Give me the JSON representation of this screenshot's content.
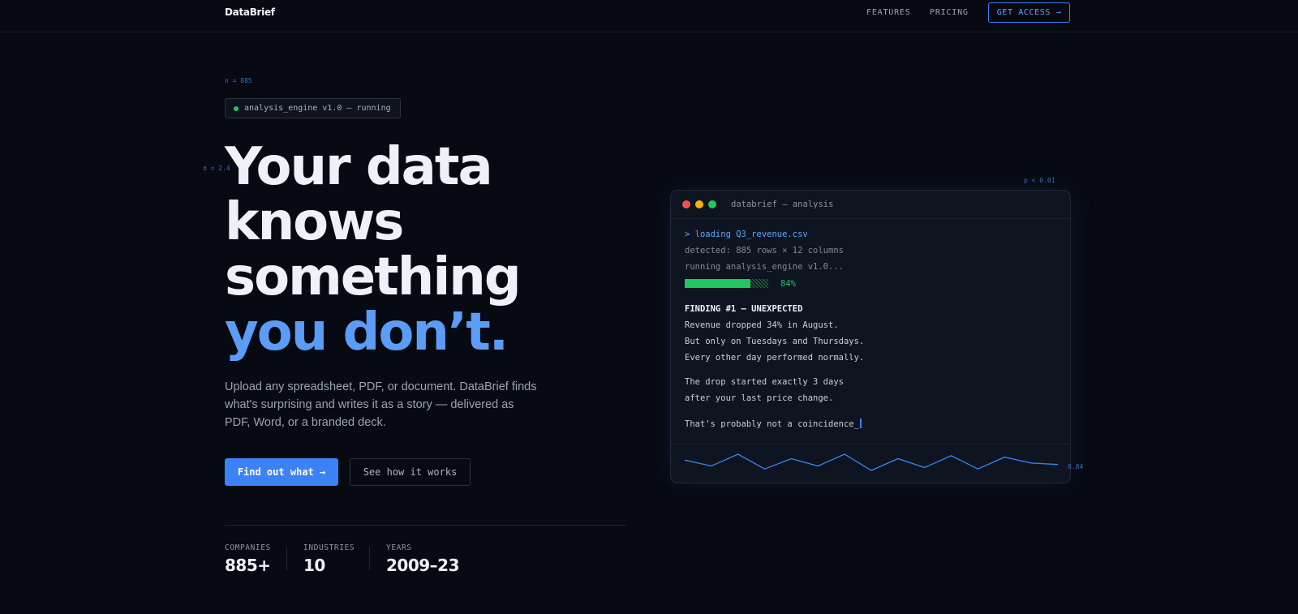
{
  "nav": {
    "logo": "DataBrief",
    "links": [
      "FEATURES",
      "PRICING"
    ],
    "cta": "GET ACCESS →"
  },
  "annotations": {
    "n": "n = 885",
    "sigma": "σ = 2.4",
    "p": "p < 0.01",
    "r": "0.84"
  },
  "status": {
    "text": "analysis_engine v1.0 — running",
    "color": "#22c55e"
  },
  "hero": {
    "line1": "Your data",
    "line2": "knows",
    "line3": "something",
    "accent": "you don’t.",
    "subtext": "Upload any spreadsheet, PDF, or document. DataBrief finds what's surprising and writes it as a story — delivered as PDF, Word, or a branded deck.",
    "primary_button": "Find out what →",
    "secondary_button": "See how it works"
  },
  "stats": [
    {
      "label": "COMPANIES",
      "value": "885+"
    },
    {
      "label": "INDUSTRIES",
      "value": "10"
    },
    {
      "label": "YEARS",
      "value": "2009–23"
    }
  ],
  "terminal": {
    "title": "databrief — analysis",
    "cmd": "> loading Q3_revenue.csv",
    "detected": "detected: 885 rows × 12 columns",
    "running": "running analysis_engine v1.0...",
    "progress_value": 0.84,
    "progress_label": "84%",
    "finding_title": "FINDING #1 — UNEXPECTED",
    "finding_lines": [
      "Revenue dropped 34% in August.",
      "But only on Tuesdays and Thursdays.",
      "Every other day performed normally."
    ],
    "drop_lines": [
      "The drop started exactly 3 days",
      "after your last price change."
    ],
    "conclusion": "That's probably not a coincidence_",
    "sparkline": [
      10,
      6,
      14,
      4,
      11,
      6,
      14,
      3,
      11,
      5,
      13,
      4,
      12,
      8,
      7
    ]
  },
  "colors": {
    "accent": "#3b82f6",
    "accent_text": "#5b9cf6",
    "success": "#22c55e",
    "background": "#070a12"
  }
}
